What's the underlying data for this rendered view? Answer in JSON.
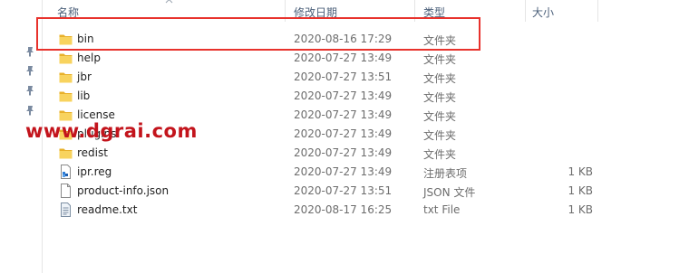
{
  "columns": {
    "name": "名称",
    "modified": "修改日期",
    "type": "类型",
    "size": "大小"
  },
  "files": [
    {
      "name": "bin",
      "modified": "2020-08-16 17:29",
      "type": "文件夹",
      "size": "",
      "icon": "folder-icon"
    },
    {
      "name": "help",
      "modified": "2020-07-27 13:49",
      "type": "文件夹",
      "size": "",
      "icon": "folder-icon"
    },
    {
      "name": "jbr",
      "modified": "2020-07-27 13:51",
      "type": "文件夹",
      "size": "",
      "icon": "folder-icon"
    },
    {
      "name": "lib",
      "modified": "2020-07-27 13:49",
      "type": "文件夹",
      "size": "",
      "icon": "folder-icon"
    },
    {
      "name": "license",
      "modified": "2020-07-27 13:49",
      "type": "文件夹",
      "size": "",
      "icon": "folder-icon"
    },
    {
      "name": "plugins",
      "modified": "2020-07-27 13:49",
      "type": "文件夹",
      "size": "",
      "icon": "folder-icon"
    },
    {
      "name": "redist",
      "modified": "2020-07-27 13:49",
      "type": "文件夹",
      "size": "",
      "icon": "folder-icon"
    },
    {
      "name": "ipr.reg",
      "modified": "2020-07-27 13:49",
      "type": "注册表项",
      "size": "1 KB",
      "icon": "registry-file-icon"
    },
    {
      "name": "product-info.json",
      "modified": "2020-07-27 13:51",
      "type": "JSON 文件",
      "size": "1 KB",
      "icon": "json-file-icon"
    },
    {
      "name": "readme.txt",
      "modified": "2020-08-17 16:25",
      "type": "txt File",
      "size": "1 KB",
      "icon": "text-file-icon"
    }
  ],
  "watermark": "www.dgrai.com",
  "colors": {
    "highlight": "#e8322c",
    "watermark": "#c3141c",
    "folder": "#f3c13a",
    "header_text": "#4c607a"
  }
}
